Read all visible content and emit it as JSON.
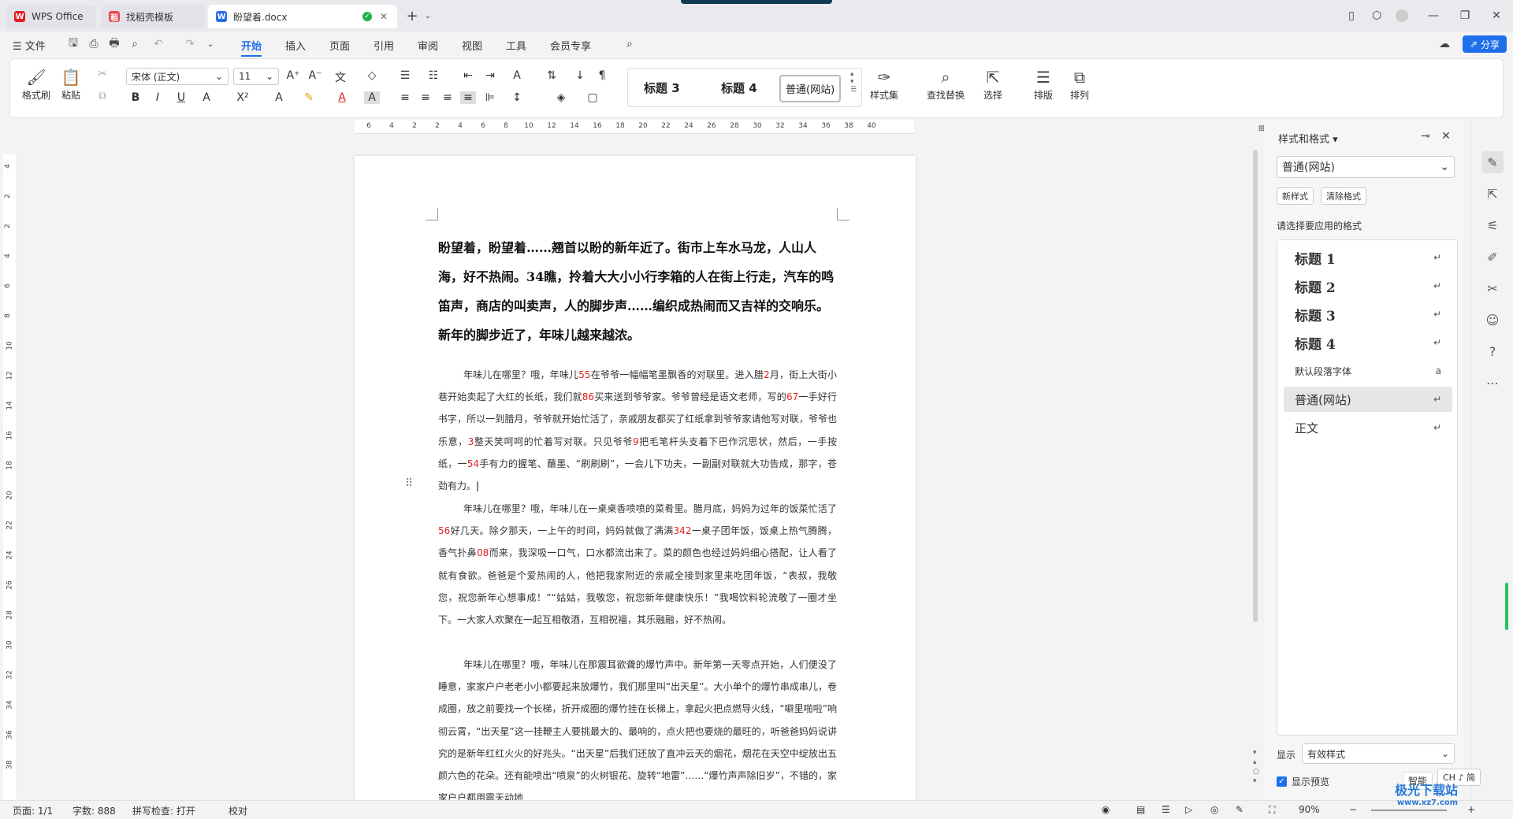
{
  "tabs": [
    {
      "label": "WPS Office"
    },
    {
      "label": "找稻壳模板"
    },
    {
      "label": "盼望着.docx"
    }
  ],
  "menu": {
    "file": "文件",
    "items": [
      "开始",
      "插入",
      "页面",
      "引用",
      "审阅",
      "视图",
      "工具",
      "会员专享"
    ],
    "share": "分享"
  },
  "ribbon": {
    "format_painter": "格式刷",
    "paste": "粘贴",
    "font_name": "宋体 (正文)",
    "font_size": "11",
    "style_gallery": [
      "标题 3",
      "标题 4",
      "普通(网站)"
    ],
    "styles": "样式集",
    "find_replace": "查找替换",
    "select": "选择",
    "typeset": "排版",
    "arrange": "排列"
  },
  "ruler": [
    "6",
    "4",
    "2",
    "2",
    "4",
    "6",
    "8",
    "10",
    "12",
    "14",
    "16",
    "18",
    "20",
    "22",
    "24",
    "26",
    "28",
    "30",
    "32",
    "34",
    "36",
    "38",
    "40"
  ],
  "vruler": [
    "4",
    "2",
    "2",
    "4",
    "6",
    "8",
    "10",
    "12",
    "14",
    "16",
    "18",
    "20",
    "22",
    "24",
    "26",
    "28",
    "30",
    "32",
    "34",
    "36",
    "38"
  ],
  "doc": {
    "heading": "盼望着，盼望着……翘首以盼的新年近了。街市上车水马龙，人山人海，好不热闹。34瞧，拎着大大小小行李箱的人在街上行走，汽车的鸣笛声，商店的叫卖声，人的脚步声……编织成热闹而又吉祥的交响乐。新年的脚步近了，年味儿越来越浓。",
    "p1": [
      [
        "年味儿在哪里？哦，年味儿",
        false
      ],
      [
        "55",
        true
      ],
      [
        "在爷爷一幅幅笔墨飘香的对联里。进入腊",
        false
      ],
      [
        "2",
        true
      ],
      [
        "月，街上大街小巷开始卖起了大红的长纸，我们就",
        false
      ],
      [
        "86",
        true
      ],
      [
        "买来送到爷爷家。爷爷曾经是语文老师，写的",
        false
      ],
      [
        "67",
        true
      ],
      [
        "一手好行书字，所以一到腊月，爷爷就开始忙活了，亲戚朋友都买了红纸拿到爷爷家请他写对联，爷爷也乐意，",
        false
      ],
      [
        "3",
        true
      ],
      [
        "整天笑呵呵的忙着写对联。只见爷爷",
        false
      ],
      [
        "9",
        true
      ],
      [
        "把毛笔杆头支着下巴作沉思状，然后，一手按纸，一",
        false
      ],
      [
        "54",
        true
      ],
      [
        "手有力的握笔、蘸墨、“刷刷刷”，一会儿下功夫，一副副对联就大功告成，那字，苍劲有力。",
        false
      ]
    ],
    "p2": [
      [
        "年味儿在哪里？哦，年味儿在一桌桌香喷喷的菜肴里。腊月底，妈妈为过年的饭菜忙活了",
        false
      ],
      [
        "56",
        true
      ],
      [
        "好几天。除夕那天，一上午的时间，妈妈就做了满满",
        false
      ],
      [
        "342",
        true
      ],
      [
        "一桌子团年饭，饭桌上热气腾腾，香气扑鼻",
        false
      ],
      [
        "08",
        true
      ],
      [
        "而来，我深吸一口气，口水都流出来了。菜的颜色也经过妈妈细心搭配，让人看了就有食欲。爸爸是个爱热闹的人，他把我家附近的亲戚全接到家里来吃团年饭，“表叔，我敬您，祝您新年心想事成！”“姑姑，我敬您，祝您新年健康快乐！”我喝饮料轮流敬了一圈才坐下。一大家人欢聚在一起互相敬酒，互相祝福，其乐融融，好不热闹。",
        false
      ]
    ],
    "p3": "年味儿在哪里？哦，年味儿在那震耳欲聋的爆竹声中。新年第一天零点开始，人们便没了睡意，家家户户老老小小都要起来放爆竹，我们那里叫“出天星”。大小单个的爆竹串成串儿，卷成圈，放之前要找一个长梯，折开成圈的爆竹挂在长梯上，拿起火把点燃导火线，“噼里啪啦”响彻云霄，“出天星”这一挂鞭主人要挑最大的、最响的，点火把也要烧的最旺的，听爸爸妈妈说讲究的是新年红红火火的好兆头。“出天星”后我们还放了直冲云天的烟花，烟花在天空中绽放出五颜六色的花朵。还有能喷出“喷泉”的火树银花、旋转“地雷”……“爆竹声声除旧岁”，不错的，家家户户都用震天动地"
  },
  "sidebar": {
    "title": "样式和格式",
    "current": "普通(网站)",
    "new_style": "新样式",
    "clear_format": "清除格式",
    "hint": "请选择要应用的格式",
    "items": [
      {
        "label": "标题  1",
        "kind": "h"
      },
      {
        "label": "标题  2",
        "kind": "h"
      },
      {
        "label": "标题  3",
        "kind": "h"
      },
      {
        "label": "标题 4",
        "kind": "h"
      },
      {
        "label": "默认段落字体",
        "kind": "s"
      },
      {
        "label": "普通(网站)",
        "kind": "n"
      },
      {
        "label": "正文",
        "kind": "n"
      }
    ],
    "show_label": "显示",
    "show_value": "有效样式",
    "preview_label": "显示预览",
    "smart": "智能"
  },
  "status": {
    "page": "页面: 1/1",
    "words": "字数: 888",
    "spell": "拼写检查: 打开",
    "proof": "校对",
    "zoom": "90%",
    "ime": "CH ♪ 简"
  },
  "watermark": "极光下载站",
  "watermark_url": "www.xz7.com",
  "colors": {
    "accent": "#1f6feb",
    "wps_red": "#e02020",
    "sidebar_sel": "#e6e6e6"
  }
}
